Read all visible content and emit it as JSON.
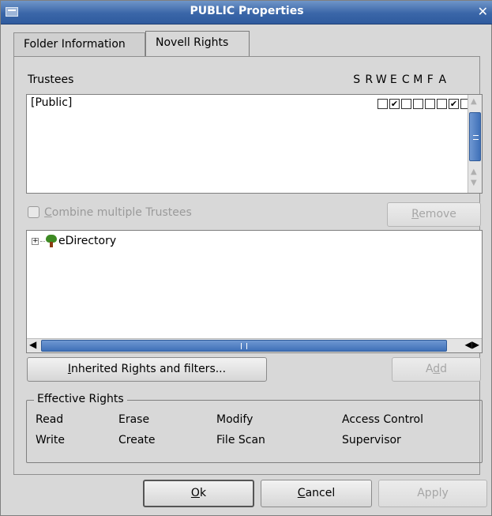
{
  "window": {
    "title": "PUBLIC Properties",
    "close_glyph": "✕",
    "icon": "window-icon"
  },
  "tabs": [
    {
      "label": "Folder Information",
      "active": false
    },
    {
      "label": "Novell Rights",
      "active": true
    }
  ],
  "trustees": {
    "header": "Trustees",
    "rights_letters": [
      "S",
      "R",
      "W",
      "E",
      "C",
      "M",
      "F",
      "A"
    ],
    "rows": [
      {
        "name": "[Public]",
        "rights": [
          false,
          true,
          false,
          false,
          false,
          false,
          true,
          false
        ]
      }
    ]
  },
  "combine_checkbox": {
    "label_first": "C",
    "label_rest": "ombine multiple Trustees",
    "checked": false,
    "enabled": false
  },
  "remove_button": {
    "label_first": "R",
    "label_rest": "emove",
    "enabled": false
  },
  "tree": {
    "items": [
      {
        "label": "eDirectory",
        "icon": "tree-icon",
        "expander": "+"
      }
    ]
  },
  "inherited_button": {
    "label_first": "I",
    "label_rest": "nherited Rights and filters..."
  },
  "add_button": {
    "label_pre": "A",
    "label_u": "d",
    "label_post": "d",
    "enabled": false
  },
  "effective_rights": {
    "title": "Effective Rights",
    "items": [
      "Read",
      "Erase",
      "Modify",
      "Access Control",
      "Write",
      "Create",
      "File Scan",
      "Supervisor"
    ]
  },
  "footer": {
    "ok": {
      "label_first": "O",
      "label_rest": "k"
    },
    "cancel": {
      "label_first": "C",
      "label_rest": "ancel"
    },
    "apply": {
      "label": "Apply",
      "enabled": false
    }
  },
  "colors": {
    "titlebar": "#3a66a8",
    "scroll_thumb": "#4a7bc2",
    "dialog_bg": "#d8d8d8"
  }
}
